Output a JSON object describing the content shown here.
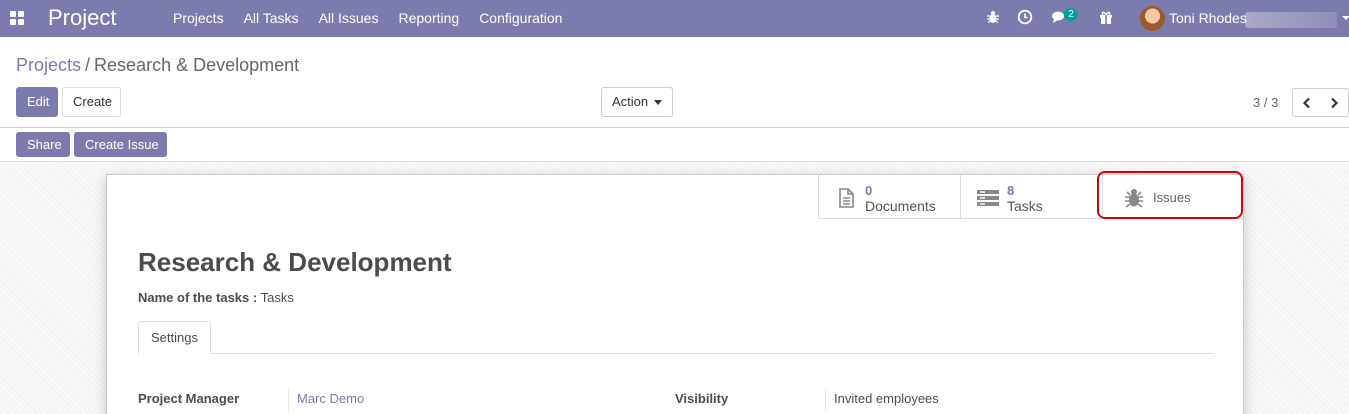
{
  "navbar": {
    "brand": "Project",
    "menu": [
      "Projects",
      "All Tasks",
      "All Issues",
      "Reporting",
      "Configuration"
    ],
    "chat_badge": "2",
    "user_name": "Toni Rhodes"
  },
  "control_panel": {
    "breadcrumb": {
      "parent": "Projects",
      "separator": "/",
      "current": "Research & Development"
    },
    "edit_label": "Edit",
    "create_label": "Create",
    "action_label": "Action",
    "pager_value": "3 / 3"
  },
  "statusbar": {
    "share_label": "Share",
    "create_issue_label": "Create Issue"
  },
  "smart_buttons": {
    "documents": {
      "count": "0",
      "label": "Documents",
      "icon": "document-icon"
    },
    "tasks": {
      "count": "8",
      "label": "Tasks",
      "icon": "tasks-list-icon"
    },
    "issues": {
      "label": "Issues",
      "icon": "bug-icon"
    }
  },
  "highlight_color": "#d9000d",
  "accent_color": "#7c7bad",
  "form": {
    "title": "Research & Development",
    "tasks_name_label": "Name of the tasks :",
    "tasks_name_value": "Tasks",
    "tab_settings": "Settings",
    "project_manager_label": "Project Manager",
    "project_manager_value": "Marc Demo",
    "visibility_label": "Visibility",
    "visibility_value": "Invited employees"
  }
}
